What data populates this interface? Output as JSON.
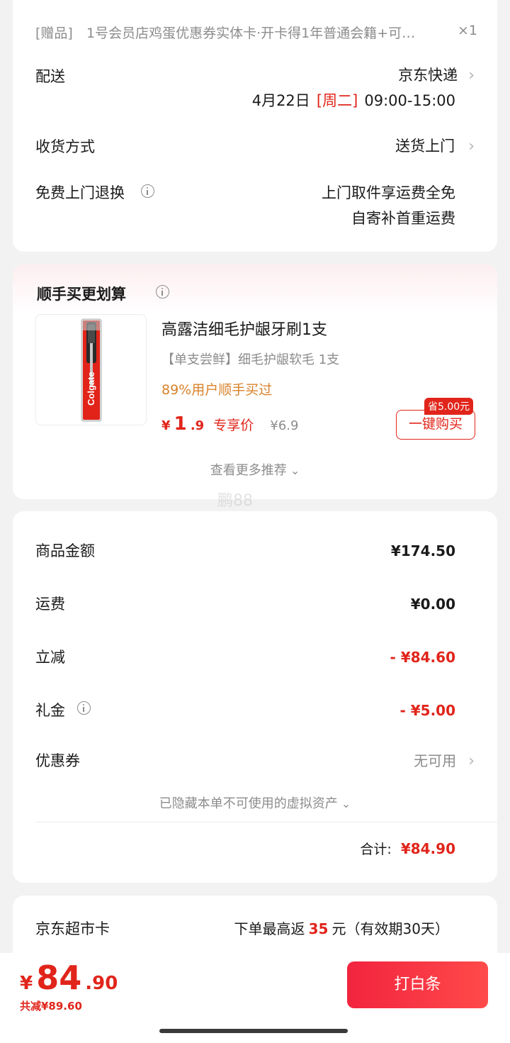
{
  "gift": {
    "tag": "[赠品]",
    "name": "1号会员店鸡蛋优惠券实体卡·开卡得1年普通会籍+可…",
    "qty": "×1"
  },
  "delivery": {
    "label": "配送",
    "method": "京东快递",
    "date": "4月22日",
    "weekday": "[周二]",
    "time": "09:00-15:00"
  },
  "receive": {
    "label": "收货方式",
    "value": "送货上门"
  },
  "return": {
    "label": "免费上门退换",
    "line1": "上门取件享运费全免",
    "line2": "自寄补首重运费"
  },
  "addon": {
    "title": "顺手买更划算",
    "product_name": "高露洁细毛护龈牙刷1支",
    "product_desc": "【单支尝鲜】细毛护龈软毛 1支",
    "social_proof": "89%用户顺手买过",
    "price_symbol": "¥",
    "price_int": "1",
    "price_dec": ".9",
    "price_tag": "专享价",
    "orig_price": "¥6.9",
    "save_badge": "省5.00元",
    "buy_button": "一键购买",
    "more": "查看更多推荐",
    "brand_text": "Colgate"
  },
  "watermark": "鹏88",
  "summary": {
    "goods_label": "商品金额",
    "goods_value": "¥174.50",
    "shipping_label": "运费",
    "shipping_value": "¥0.00",
    "discount_label": "立减",
    "discount_value": "- ¥84.60",
    "gift_label": "礼金",
    "gift_value": "- ¥5.00",
    "coupon_label": "优惠券",
    "coupon_value": "无可用",
    "hidden_assets": "已隐藏本单不可使用的虚拟资产",
    "total_label": "合计:",
    "total_value": "¥84.90"
  },
  "supermarket": {
    "label": "京东超市卡",
    "text_before": "下单最高返",
    "amount": "35",
    "text_after": "元（有效期30天）"
  },
  "bottom": {
    "price_symbol": "¥",
    "price_int": "84",
    "price_dec": ".90",
    "saved": "共减¥89.60",
    "pay_button": "打白条"
  },
  "colors": {
    "accent": "#e1251b",
    "button_gradient_start": "#f2243f",
    "button_gradient_end": "#ff4a4a",
    "orange": "#d9822b"
  }
}
